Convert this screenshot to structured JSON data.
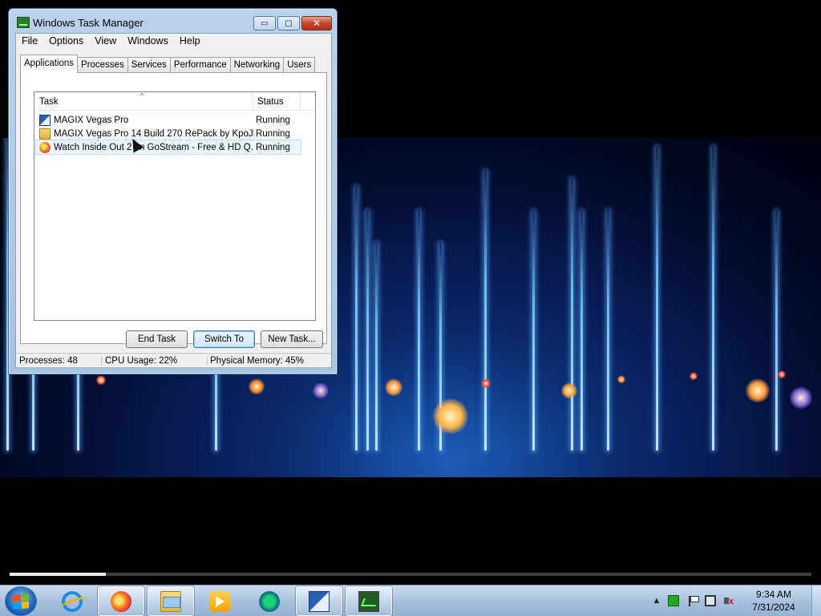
{
  "window": {
    "title": "Windows Task Manager",
    "min_label": "▭",
    "max_label": "▢",
    "close_label": "✕"
  },
  "menu": [
    "File",
    "Options",
    "View",
    "Windows",
    "Help"
  ],
  "tabs": [
    "Applications",
    "Processes",
    "Services",
    "Performance",
    "Networking",
    "Users"
  ],
  "active_tab": "Applications",
  "task_list": {
    "columns": [
      "Task",
      "Status"
    ],
    "sort_indicator": "^",
    "rows": [
      {
        "task": "MAGIX Vegas Pro",
        "status": "Running",
        "icon": "vegas-icon"
      },
      {
        "task": "MAGIX Vegas Pro 14 Build 270 RePack by KpoJIu...",
        "status": "Running",
        "icon": "folder-icon"
      },
      {
        "task": "Watch Inside Out 2 on GoStream - Free & HD Q...",
        "status": "Running",
        "icon": "firefox-icon"
      }
    ]
  },
  "buttons": {
    "end_task": "End Task",
    "switch_to": "Switch To",
    "new_task": "New Task..."
  },
  "status_bar": {
    "processes": "Processes: 48",
    "cpu": "CPU Usage: 22%",
    "memory": "Physical Memory: 45%"
  },
  "video": {
    "progress_fraction": 0.12
  },
  "taskbar": {
    "pinned": [
      {
        "name": "internet-explorer-icon",
        "running": false
      },
      {
        "name": "firefox-icon",
        "running": true
      },
      {
        "name": "windows-explorer-icon",
        "running": true
      },
      {
        "name": "media-player-icon",
        "running": false
      },
      {
        "name": "gostream-icon",
        "running": false
      },
      {
        "name": "vegas-pro-icon",
        "running": true
      },
      {
        "name": "task-manager-icon",
        "running": true
      }
    ],
    "tray_chevron": "▲",
    "time": "9:34 AM",
    "date": "7/31/2024"
  },
  "colors": {
    "titlebar": "#b9d1ea",
    "close_button": "#c4462e",
    "selection": "#eef5fc",
    "taskbar": "#a8c2df"
  }
}
